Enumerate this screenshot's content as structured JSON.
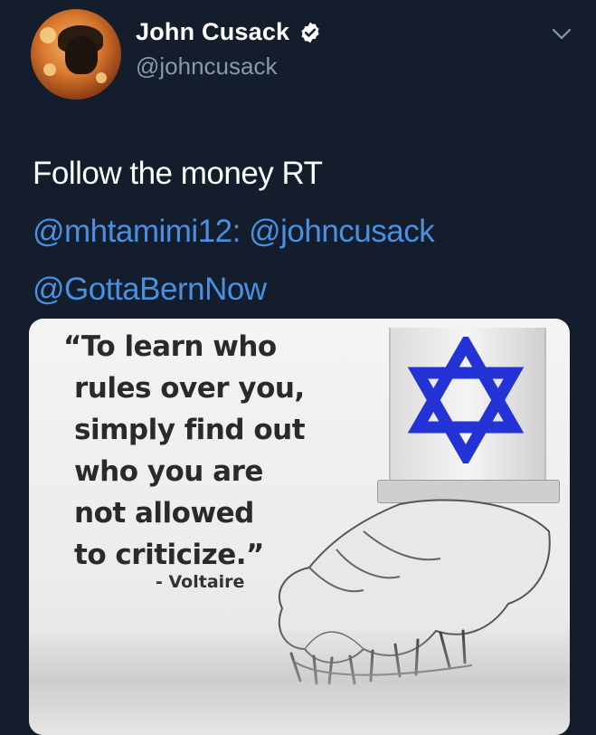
{
  "user": {
    "display_name": "John Cusack",
    "handle": "@johncusack",
    "verified": true
  },
  "tweet": {
    "line1": "Follow the money  RT",
    "line2_mention_a": "@mhtamimi12:",
    "line2_mention_b": "@johncusack",
    "line3_mention": "@GottaBernNow"
  },
  "media": {
    "quote_lines": [
      "“To learn who",
      "rules over you,",
      "simply find out",
      "who you are",
      "not allowed",
      "to criticize.”"
    ],
    "attribution": "- Voltaire"
  },
  "icons": {
    "verified": "verified-badge-icon",
    "menu": "chevron-down-icon",
    "symbol": "star-of-david-icon"
  },
  "colors": {
    "background": "#141d2b",
    "mention": "#4a90e2",
    "handle": "#8899a6",
    "star": "#2433d6"
  }
}
